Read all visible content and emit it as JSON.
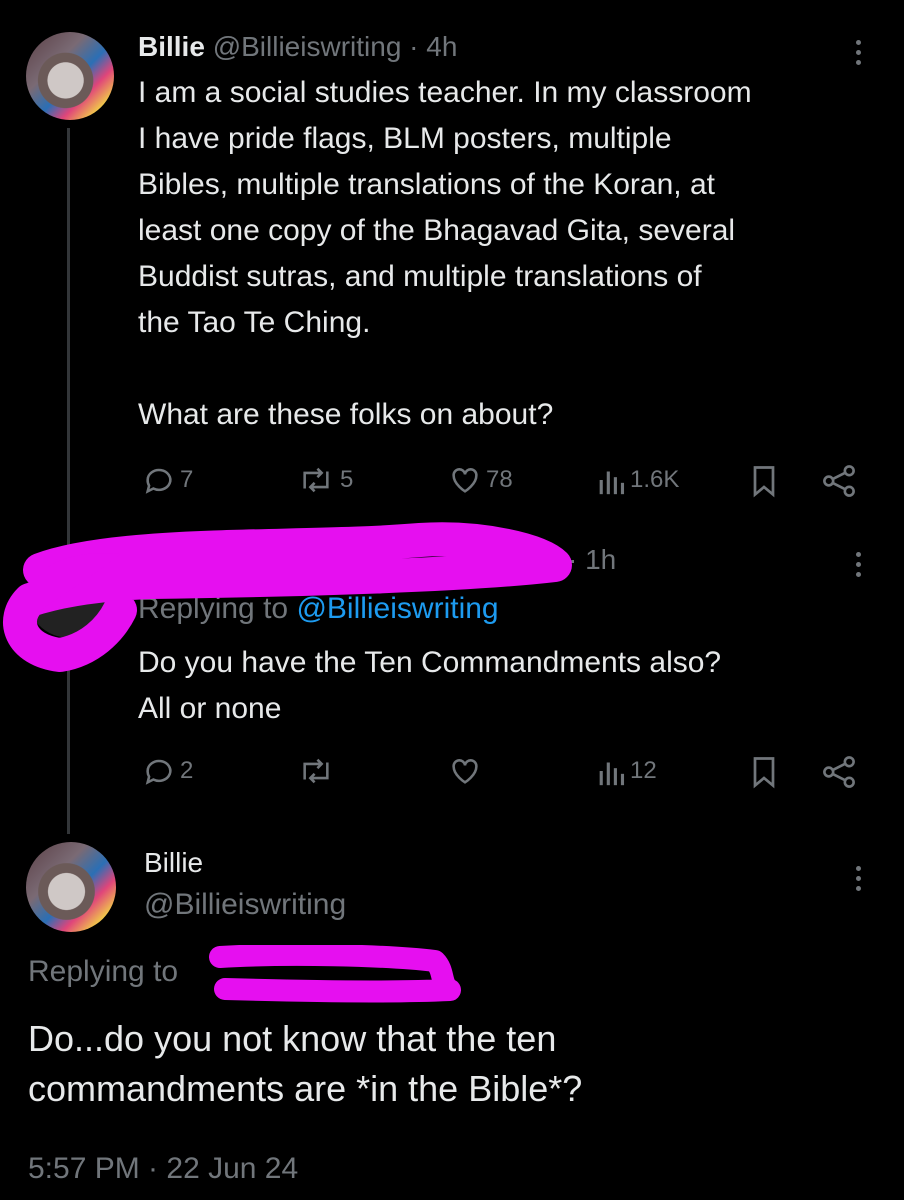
{
  "tweet1": {
    "display_name": "Billie",
    "handle": "@Billieiswriting",
    "time": "· 4h",
    "text_lines": [
      "I am a social studies teacher. In my classroom",
      "I have pride flags, BLM posters, multiple",
      "Bibles, multiple translations of the Koran, at",
      "least one copy of the Bhagavad Gita, several",
      "Buddist sutras, and multiple translations of",
      "the Tao Te Ching."
    ],
    "text_para2": "What are these folks on about?",
    "actions": {
      "replies": "7",
      "reposts": "5",
      "likes": "78",
      "views": "1.6K"
    }
  },
  "tweet2": {
    "time": "· 1h",
    "replying_prefix": "Replying to",
    "replying_handle": "@Billieiswriting",
    "text_lines": [
      "Do you have the Ten Commandments also?",
      "All or none"
    ],
    "actions": {
      "replies": "2",
      "reposts": "",
      "likes": "",
      "views": "12"
    }
  },
  "tweet3": {
    "display_name": "Billie",
    "handle": "@Billieiswriting",
    "replying_prefix": "Replying to",
    "text_lines": [
      "Do...do you not know that the ten",
      "commandments are *in the Bible*?"
    ],
    "timestamp": "5:57 PM · 22 Jun 24"
  },
  "colors": {
    "background": "#000000",
    "text": "#e7e9ea",
    "muted": "#71767b",
    "link": "#1d9bf0",
    "redaction": "#e60ff0"
  },
  "icons": [
    "reply-icon",
    "repost-icon",
    "like-icon",
    "views-icon",
    "bookmark-icon",
    "share-icon",
    "more-icon"
  ]
}
